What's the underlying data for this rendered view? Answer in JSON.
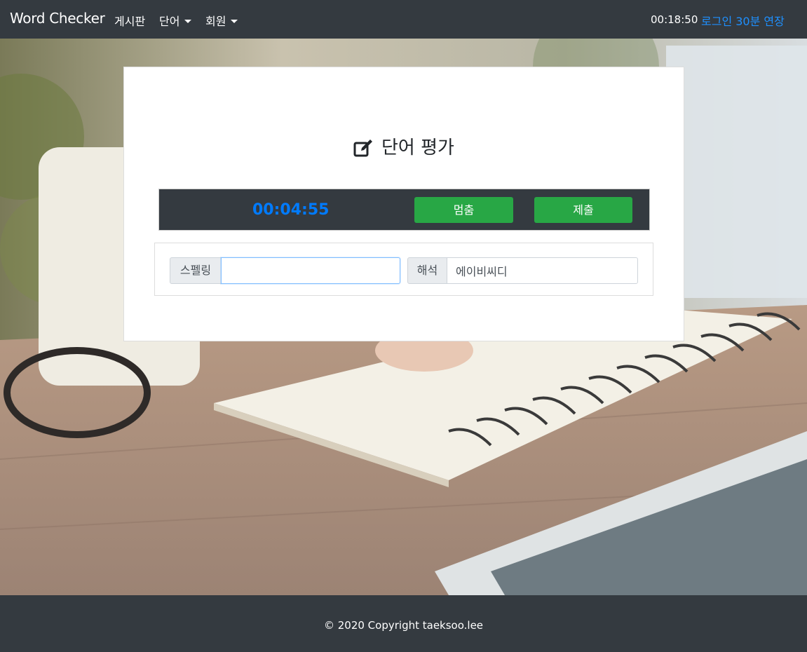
{
  "navbar": {
    "brand": "Word Checker",
    "menu": [
      {
        "label": "게시판"
      },
      {
        "label": "단어"
      },
      {
        "label": "회원"
      }
    ],
    "clock": "00:18:50",
    "extend_login_label": "로그인 30분 연장"
  },
  "card": {
    "title": "단어 평가",
    "title_icon": "edit-icon",
    "timer": "00:04:55",
    "pause_label": "멈춤",
    "submit_label": "제출",
    "spelling_label": "스펠링",
    "spelling_value": "",
    "meaning_label": "해석",
    "meaning_value": "에이비씨디"
  },
  "footer": {
    "copyright": "© 2020 Copyright  taeksoo.lee"
  },
  "colors": {
    "navbar_bg": "#343a40",
    "timer_text": "#007bff",
    "button_green": "#28a745",
    "link_blue": "#1e90ff"
  }
}
